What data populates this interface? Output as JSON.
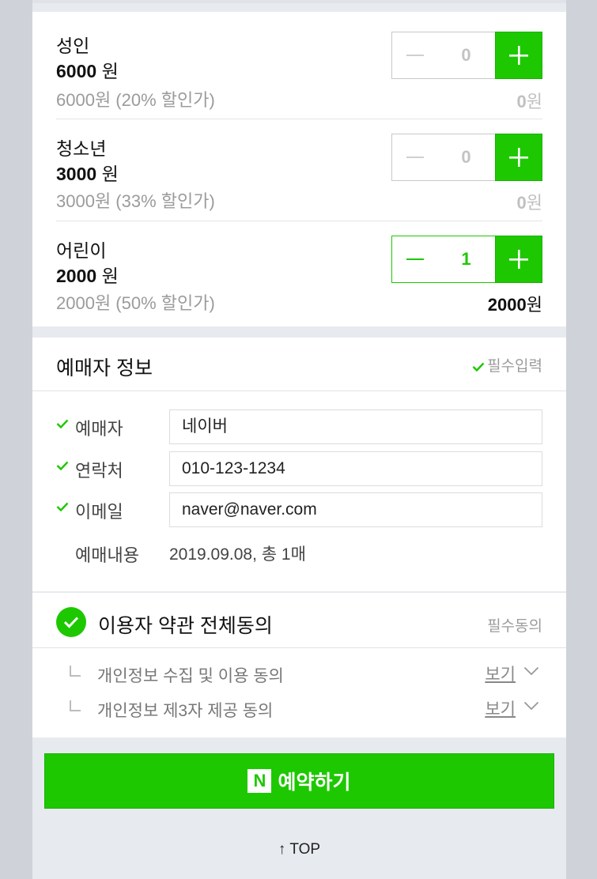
{
  "tickets": [
    {
      "name": "성인",
      "price": "6000",
      "currency": "원",
      "note": "6000원 (20% 할인가)",
      "qty": "0",
      "subtotal": "0",
      "subtotal_unit": "원",
      "active": false
    },
    {
      "name": "청소년",
      "price": "3000",
      "currency": "원",
      "note": "3000원 (33% 할인가)",
      "qty": "0",
      "subtotal": "0",
      "subtotal_unit": "원",
      "active": false
    },
    {
      "name": "어린이",
      "price": "2000",
      "currency": "원",
      "note": "2000원 (50% 할인가)",
      "qty": "1",
      "subtotal": "2000",
      "subtotal_unit": "원",
      "active": true
    }
  ],
  "booker": {
    "title": "예매자 정보",
    "required_label": "필수입력",
    "fields": [
      {
        "label": "예매자",
        "value": "네이버"
      },
      {
        "label": "연락처",
        "value": "010-123-1234"
      },
      {
        "label": "이메일",
        "value": "naver@naver.com"
      }
    ],
    "summary": {
      "label": "예매내용",
      "value": "2019.09.08, 총 1매"
    }
  },
  "agreement": {
    "title": "이용자 약관 전체동의",
    "required_label": "필수동의",
    "items": [
      {
        "text": "개인정보 수집 및 이용 동의",
        "view": "보기"
      },
      {
        "text": "개인정보 제3자 제공 동의",
        "view": "보기"
      }
    ]
  },
  "reserve_button": {
    "logo": "N",
    "label": "예약하기"
  },
  "top_link": "↑ TOP",
  "colors": {
    "accent": "#1ec800",
    "muted": "#9b9b9b"
  },
  "icons": [
    "minus-icon",
    "plus-icon",
    "check-icon",
    "check-circle-icon",
    "chevron-down-icon",
    "corner-icon"
  ]
}
